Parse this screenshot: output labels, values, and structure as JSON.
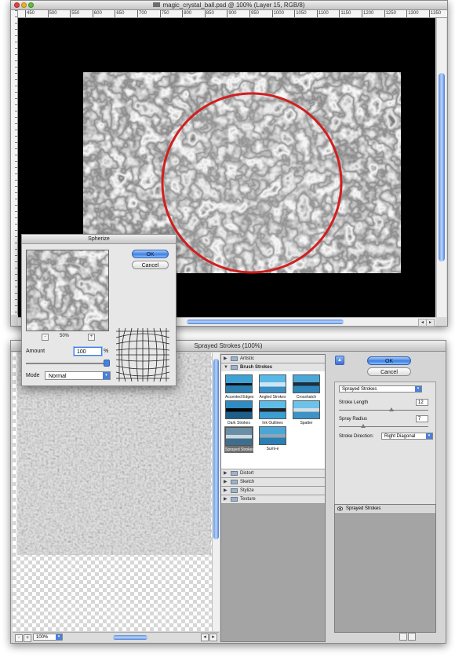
{
  "document": {
    "title": "magic_crystal_ball.psd @ 100% (Layer 15, RGB/8)",
    "ruler_ticks": [
      "450",
      "500",
      "550",
      "600",
      "650",
      "700",
      "750",
      "800",
      "850",
      "900",
      "950",
      "1000",
      "1050",
      "1100",
      "1150",
      "1200",
      "1250",
      "1300",
      "1350"
    ]
  },
  "spherize": {
    "title": "Spherize",
    "ok_label": "OK",
    "cancel_label": "Cancel",
    "zoom_minus": "-",
    "zoom_plus": "+",
    "zoom_value": "50%",
    "amount_label": "Amount",
    "amount_value": "100",
    "amount_unit": "%",
    "amount_slider_fraction": 1.0,
    "mode_label": "Mode",
    "mode_value": "Normal"
  },
  "filter_gallery": {
    "title": "Sprayed Strokes (100%)",
    "zoom_value": "100%",
    "zoom_minus": "-",
    "zoom_plus": "+",
    "categories": [
      {
        "label": "Artistic",
        "expanded": false
      },
      {
        "label": "Brush Strokes",
        "expanded": true
      },
      {
        "label": "Distort",
        "expanded": false
      },
      {
        "label": "Sketch",
        "expanded": false
      },
      {
        "label": "Stylize",
        "expanded": false
      },
      {
        "label": "Texture",
        "expanded": false
      }
    ],
    "brush_stroke_filters": [
      {
        "label": "Accented Edges"
      },
      {
        "label": "Angled Strokes"
      },
      {
        "label": "Crosshatch"
      },
      {
        "label": "Dark Strokes"
      },
      {
        "label": "Ink Outlines"
      },
      {
        "label": "Spatter"
      },
      {
        "label": "Sprayed Strokes",
        "selected": true
      },
      {
        "label": "Sumi-e"
      }
    ],
    "ok_label": "OK",
    "cancel_label": "Cancel",
    "filter_select": "Sprayed Strokes",
    "params": {
      "stroke_length_label": "Stroke Length",
      "stroke_length_value": "12",
      "spray_radius_label": "Spray Radius",
      "spray_radius_value": "7",
      "stroke_direction_label": "Stroke Direction:",
      "stroke_direction_value": "Right Diagonal"
    },
    "layer_name": "Sprayed Strokes"
  },
  "colors": {
    "accent": "#3f7fe0",
    "selection_circle": "#d01f1f",
    "canvas_background": "#000000"
  }
}
